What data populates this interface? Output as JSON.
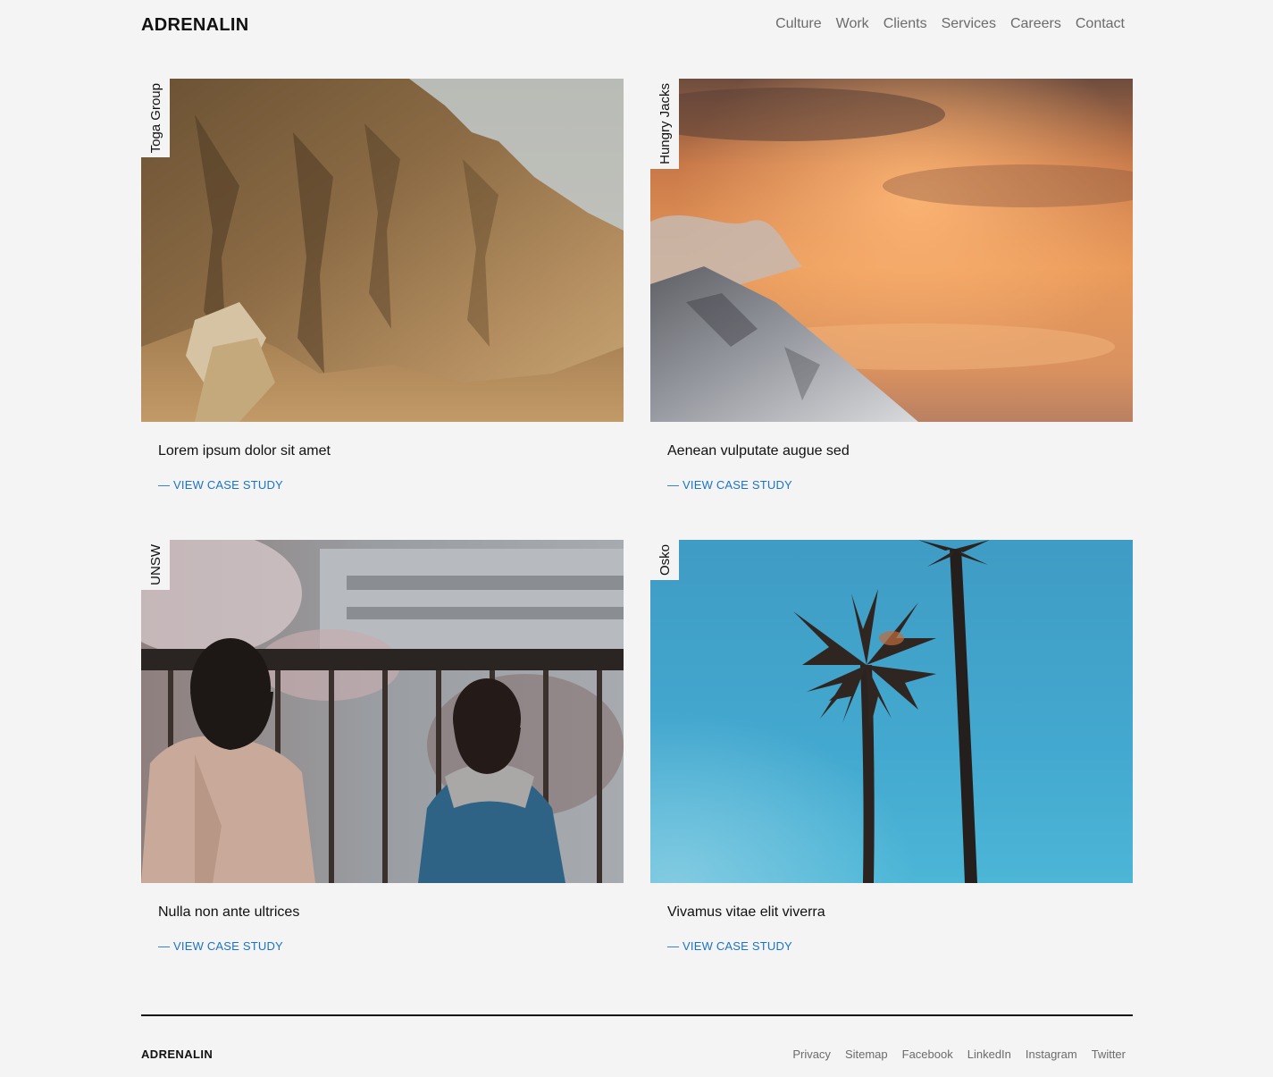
{
  "header": {
    "logo": "ADRENALIN",
    "nav": [
      "Culture",
      "Work",
      "Clients",
      "Services",
      "Careers",
      "Contact"
    ]
  },
  "cards": [
    {
      "client": "Toga Group",
      "title": "Lorem ipsum dolor sit amet",
      "link": "— VIEW CASE STUDY",
      "image": "sandstone-cliff-photo"
    },
    {
      "client": "Hungry Jacks",
      "title": "Aenean vulputate augue sed",
      "link": "— VIEW CASE STUDY",
      "image": "mountain-sunset-clouds-photo"
    },
    {
      "client": "UNSW",
      "title": "Nulla non ante ultrices",
      "link": "— VIEW CASE STUDY",
      "image": "two-people-at-railing-photo"
    },
    {
      "client": "Osko",
      "title": "Vivamus vitae elit viverra",
      "link": "— VIEW CASE STUDY",
      "image": "palm-trees-blue-sky-photo"
    }
  ],
  "footer": {
    "logo": "ADRENALIN",
    "links": [
      "Privacy",
      "Sitemap",
      "Facebook",
      "LinkedIn",
      "Instagram",
      "Twitter"
    ]
  },
  "colors": {
    "background": "#f4f4f4",
    "link": "#1a73c8",
    "nav_text": "#6b6b6b",
    "text": "#111111"
  }
}
